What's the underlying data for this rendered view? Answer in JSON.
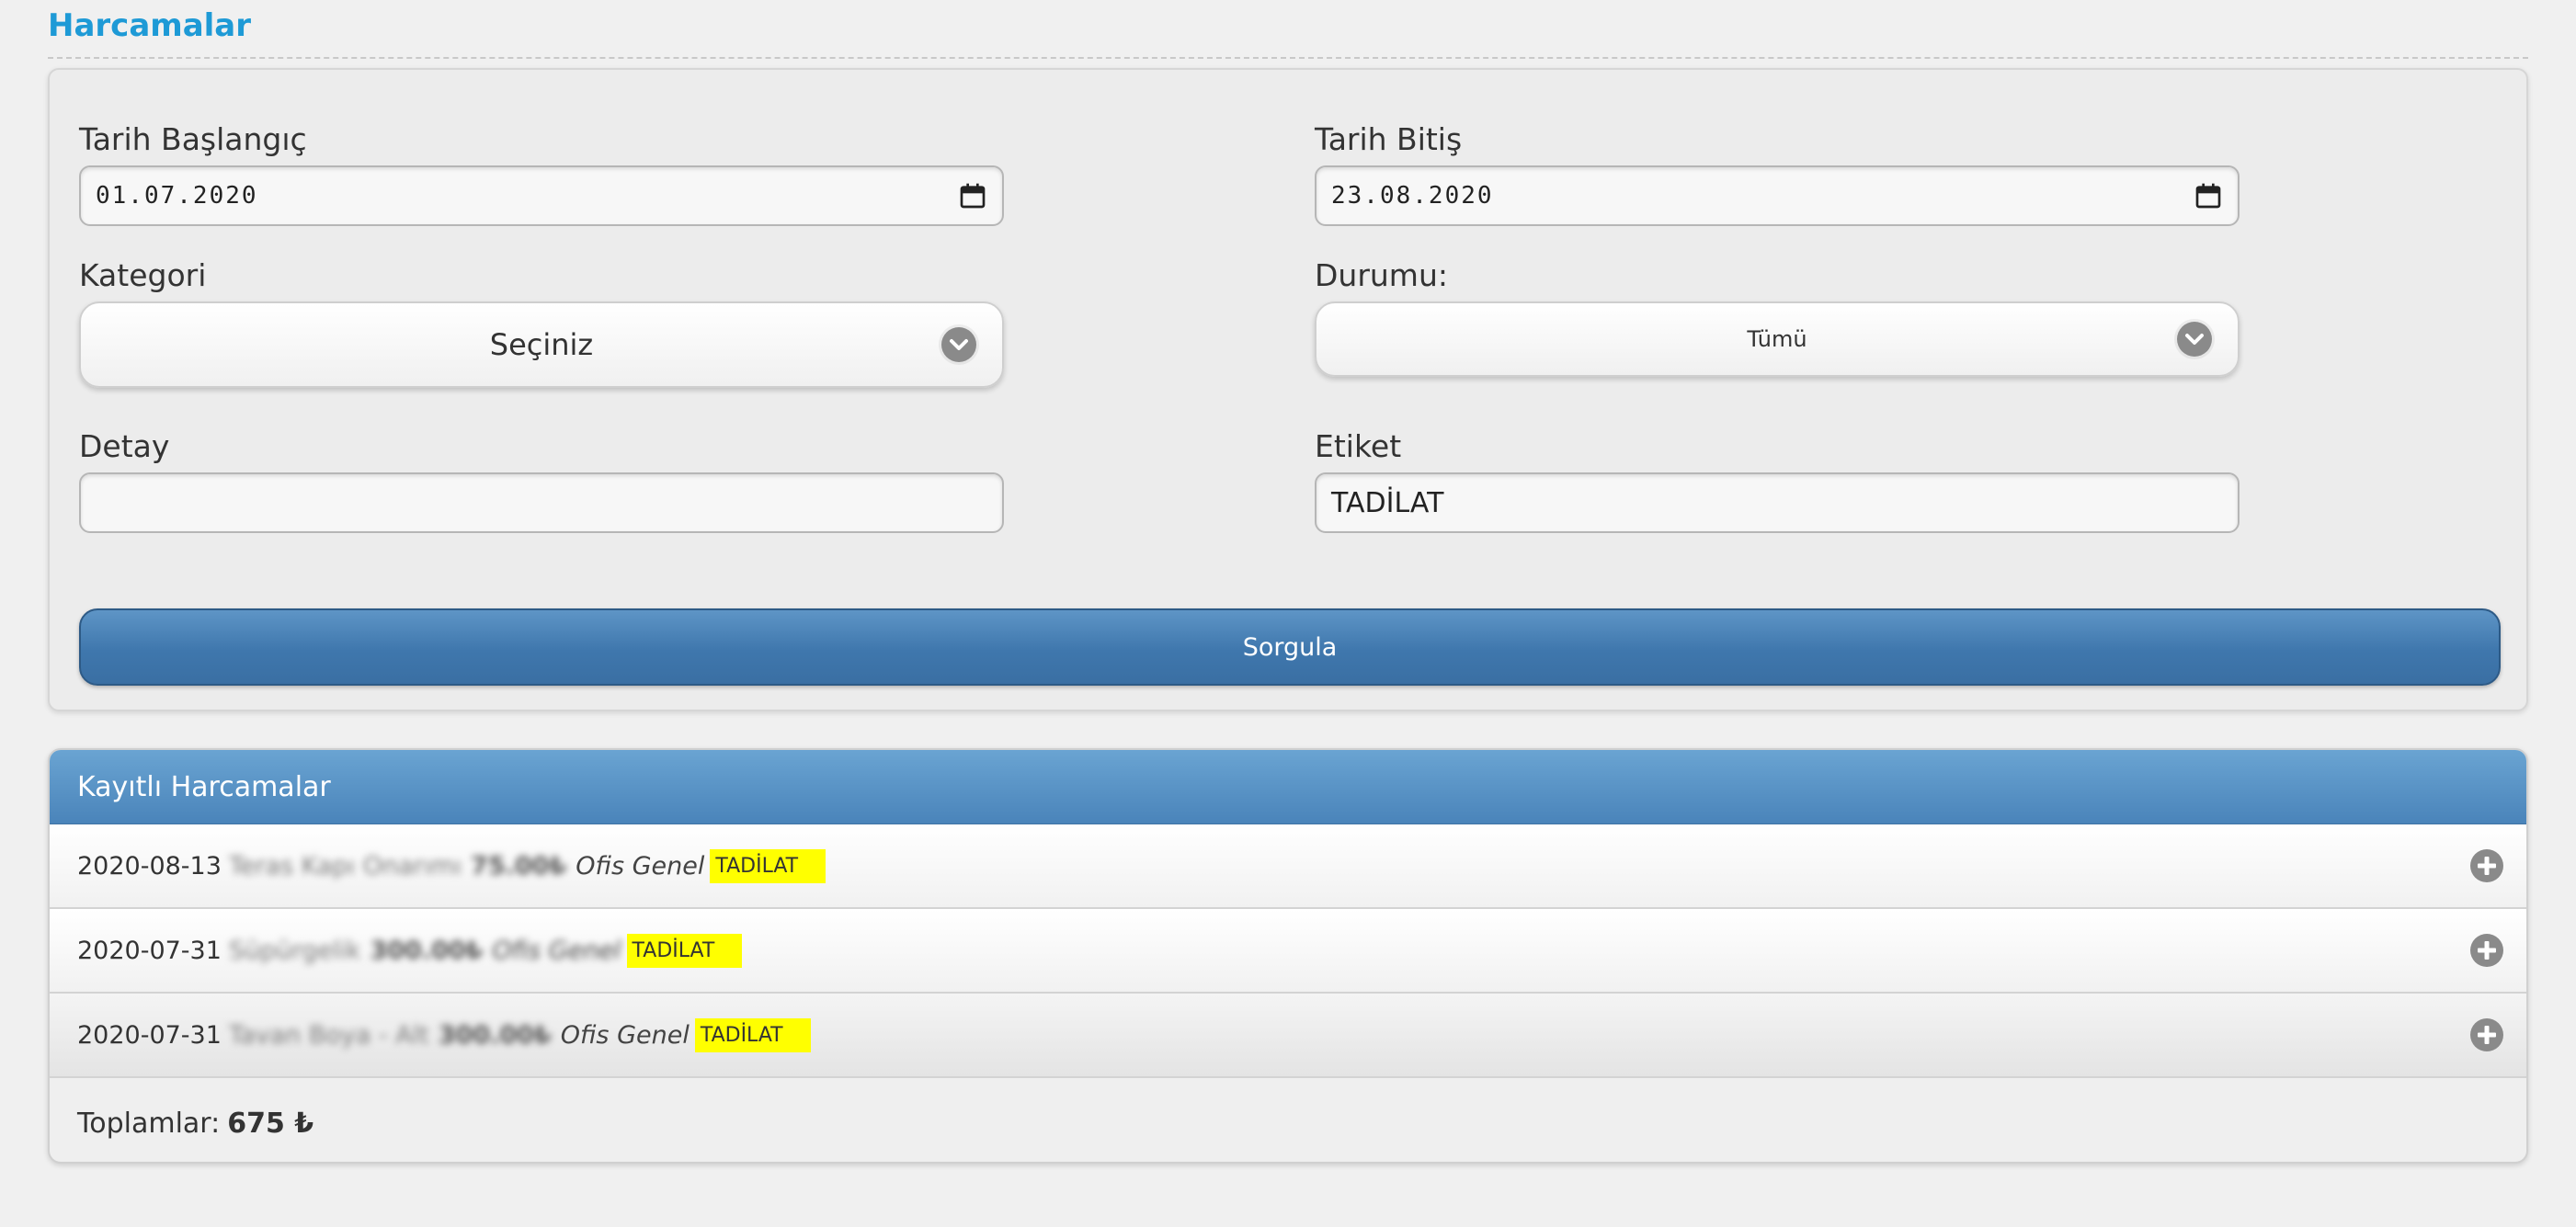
{
  "page": {
    "title": "Harcamalar"
  },
  "filters": {
    "start_date": {
      "label": "Tarih Başlangıç",
      "value": "01.07.2020"
    },
    "end_date": {
      "label": "Tarih Bitiş",
      "value": "23.08.2020"
    },
    "category": {
      "label": "Kategori",
      "selected": "Seçiniz"
    },
    "status": {
      "label": "Durumu:",
      "selected": "Tümü"
    },
    "detail": {
      "label": "Detay",
      "value": ""
    },
    "tag": {
      "label": "Etiket",
      "value": "TADİLAT"
    },
    "submit_label": "Sorgula"
  },
  "list": {
    "header": "Kayıtlı Harcamalar",
    "rows": [
      {
        "date": "2020-08-13",
        "description": "Teras Kapı Onarımı",
        "amount": "75.00₺",
        "category": "Ofis Genel",
        "tag": "TADİLAT"
      },
      {
        "date": "2020-07-31",
        "description": "Süpürgelik",
        "amount": "300.00₺",
        "category": "Ofis Genel",
        "tag": "TADİLAT"
      },
      {
        "date": "2020-07-31",
        "description": "Tavan Boya - Alt",
        "amount": "300.00₺",
        "category": "Ofis Genel",
        "tag": "TADİLAT"
      }
    ],
    "totals_label": "Toplamlar:",
    "totals_value": "675 ₺"
  },
  "colors": {
    "accent": "#1e9ad6",
    "button": "#3f77ad",
    "tag_highlight": "#ffff00"
  },
  "icons": {
    "date": "calendar-icon",
    "select": "chevron-down-icon",
    "expand": "plus-circle-icon"
  }
}
